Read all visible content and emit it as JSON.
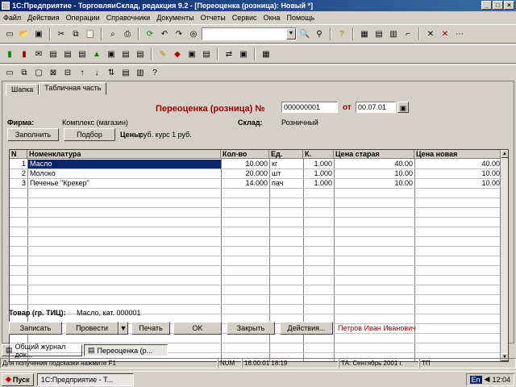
{
  "window": {
    "title": "1С:Предприятие - ТорговляиСклад, редакция 9.2 - [Переоценка (розница): Новый *]"
  },
  "menu": [
    "Файл",
    "Действия",
    "Операции",
    "Справочники",
    "Документы",
    "Отчеты",
    "Сервис",
    "Окна",
    "Помощь"
  ],
  "tabs": [
    "Шапка",
    "Табличная часть"
  ],
  "document": {
    "title": "Переоценка (розница) №",
    "number": "000000001",
    "date_label": "от",
    "date": "00.07.01",
    "firm_label": "Фирма:",
    "firm_value": "Комплекс (магазин)",
    "warehouse_label": "Склад:",
    "warehouse_value": "Розничный",
    "price_label": "Цены:",
    "price_value": "руб. курс 1 руб."
  },
  "buttons": {
    "fill": "Заполнить",
    "select": "Подбор",
    "print": "Записать",
    "post": "Провести",
    "print2": "Печать",
    "ok": "OK",
    "close": "Закрыть",
    "actions": "Действия..."
  },
  "grid": {
    "columns": [
      "N",
      "Номенклатура",
      "Кол-во",
      "Ед.",
      "К.",
      "Цена старая",
      "Цена новая"
    ],
    "rows": [
      {
        "n": "1",
        "name": "Масло",
        "qty": "10.000",
        "unit": "кг",
        "k": "1.000",
        "old": "40.00",
        "new": "40.00"
      },
      {
        "n": "2",
        "name": "Молоко",
        "qty": "20.000",
        "unit": "шт",
        "k": "1.000",
        "old": "10.00",
        "new": "10.00"
      },
      {
        "n": "3",
        "name": "Печенье \"Крекер\"",
        "qty": "14.000",
        "unit": "пач",
        "k": "1.000",
        "old": "10.00",
        "new": "10.00"
      }
    ]
  },
  "footer": {
    "goods_label": "Товар (гр. ТИЦ):",
    "goods_value": "Масло, кат. 000001",
    "author": "Петров Иван Иванович"
  },
  "mdi_tabs": [
    "Общий журнал док...",
    "Переоценка (р..."
  ],
  "status": {
    "hint": "Для получения подсказки нажмите F1",
    "caps": "NUM",
    "datetime": "16.00.01 18:19",
    "period": "ТА: Сентябрь 2001 г.",
    "mode": "ТП"
  },
  "taskbar": {
    "start": "Пуск",
    "item": "1С:Предприятие - Т...",
    "lang": "En",
    "clock": "12:04"
  }
}
